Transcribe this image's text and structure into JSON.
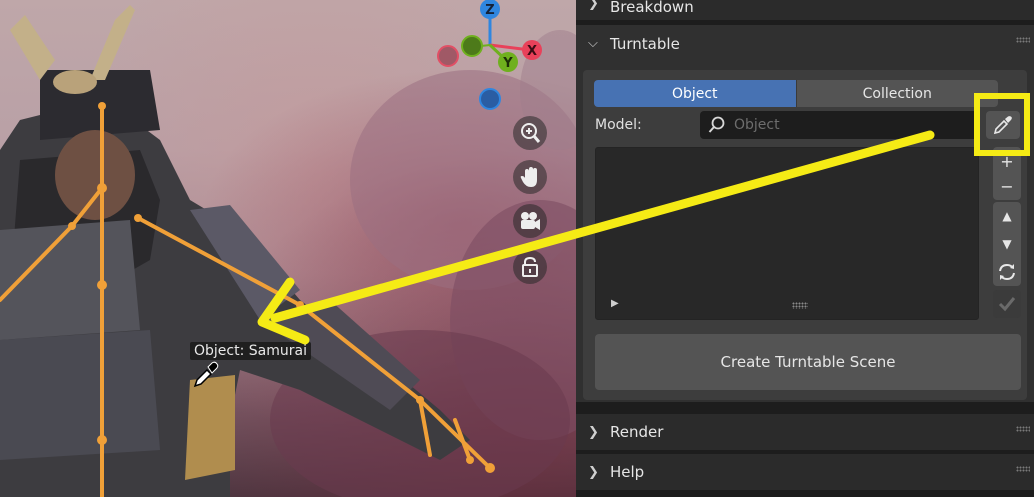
{
  "panel": {
    "breakdown_label": "Breakdown",
    "turntable_label": "Turntable",
    "tabs": [
      {
        "label": "Object",
        "active": true
      },
      {
        "label": "Collection",
        "active": false
      }
    ],
    "model_label": "Model:",
    "model_placeholder": "Object",
    "create_button_label": "Create Turntable Scene",
    "render_label": "Render",
    "help_label": "Help"
  },
  "viewport": {
    "tooltip": "Object: Samurai",
    "gizmo": {
      "z_label": "Z",
      "y_label": "Y",
      "x_label": "X"
    }
  },
  "icons": {
    "eyedropper": "eyedropper-icon",
    "search": "search-icon",
    "zoom": "zoom-in-icon",
    "pan": "hand-pan-icon",
    "camera": "camera-icon",
    "lock": "unlock-icon"
  },
  "colors": {
    "accent_tab": "#4772b3",
    "annotation": "#f5eb15",
    "armature": "#f0a038",
    "gizmo_x": "#e8415a",
    "gizmo_y": "#6fb01e",
    "gizmo_z": "#2f86e0"
  }
}
